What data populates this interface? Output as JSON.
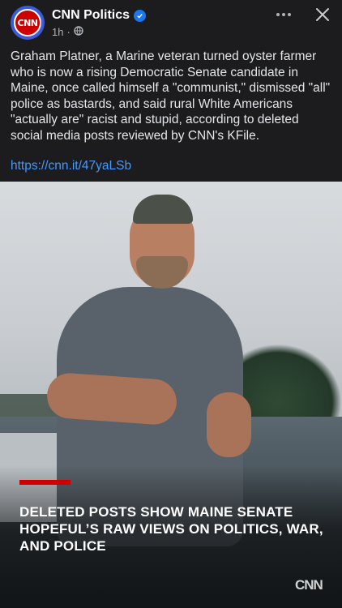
{
  "header": {
    "page_name": "CNN Politics",
    "time": "1h",
    "avatar_text": "CNN",
    "icons": {
      "verified": "verified-badge-icon",
      "audience": "globe-icon",
      "more": "more-horizontal-icon",
      "close": "close-icon"
    }
  },
  "post": {
    "text": "Graham Platner, a Marine veteran turned oyster farmer who is now a rising Democratic Senate candidate in Maine, once called himself a \"communist,\" dismissed \"all\" police as bastards, and said rural White Americans \"actually are\" racist and stupid, according to deleted social media posts reviewed by CNN's KFile.",
    "link": "https://cnn.it/47yaLSb"
  },
  "image": {
    "headline": "DELETED POSTS SHOW MAINE SENATE HOPEFUL’S RAW VIEWS ON POLITICS, WAR, AND POLICE",
    "logo": "CNN",
    "accent_color": "#cc0000"
  }
}
